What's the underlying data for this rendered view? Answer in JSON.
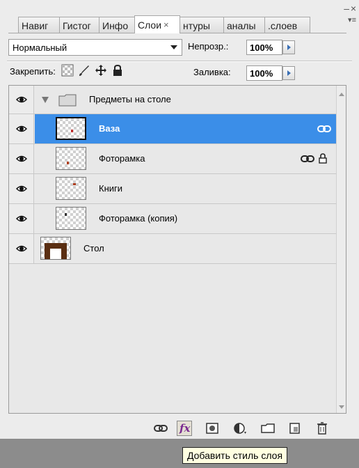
{
  "tabs": [
    {
      "label": "Навиг",
      "active": false
    },
    {
      "label": "Гистог",
      "active": false
    },
    {
      "label": "Инфо",
      "active": false
    },
    {
      "label": "Слои",
      "active": true
    },
    {
      "label": "нтуры",
      "active": false
    },
    {
      "label": "аналы",
      "active": false
    },
    {
      "label": ".слоев",
      "active": false
    }
  ],
  "blend_mode": "Нормальный",
  "opacity": {
    "label": "Непрозр.:",
    "value": "100%"
  },
  "lock": {
    "label": "Закрепить:"
  },
  "fill": {
    "label": "Заливка:",
    "value": "100%"
  },
  "layers": [
    {
      "name": "Предметы на столе",
      "type": "group"
    },
    {
      "name": "Ваза",
      "type": "layer",
      "selected": true,
      "linked": true,
      "locked": false
    },
    {
      "name": "Фоторамка",
      "type": "layer",
      "selected": false,
      "linked": true,
      "locked": true
    },
    {
      "name": "Книги",
      "type": "layer",
      "selected": false,
      "linked": false,
      "locked": false
    },
    {
      "name": "Фоторамка (копия)",
      "type": "layer",
      "selected": false,
      "linked": false,
      "locked": false
    },
    {
      "name": "Стол",
      "type": "layer",
      "selected": false,
      "linked": false,
      "locked": false
    }
  ],
  "toolbar_icons": [
    "link-icon",
    "fx-icon",
    "mask-icon",
    "adjustment-icon",
    "folder-icon",
    "new-layer-icon",
    "trash-icon"
  ],
  "tooltip": "Добавить стиль слоя",
  "colors": {
    "selection": "#3b8ee8",
    "fx": "#7a2a90"
  }
}
